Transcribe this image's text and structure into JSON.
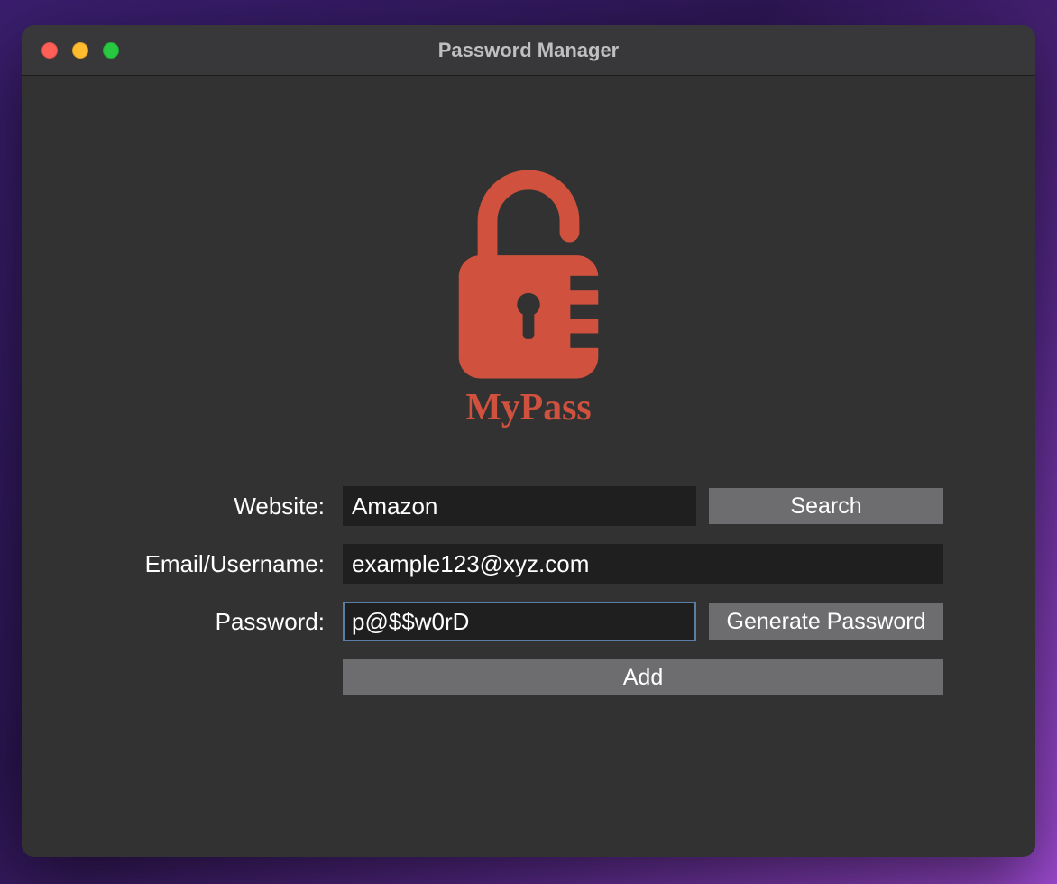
{
  "window": {
    "title": "Password Manager"
  },
  "logo": {
    "name": "MyPass",
    "color": "#d0523e"
  },
  "form": {
    "website": {
      "label": "Website:",
      "value": "Amazon"
    },
    "email": {
      "label": "Email/Username:",
      "value": "example123@xyz.com"
    },
    "password": {
      "label": "Password:",
      "value": "p@$$w0rD"
    },
    "buttons": {
      "search": "Search",
      "generate": "Generate Password",
      "add": "Add"
    }
  }
}
